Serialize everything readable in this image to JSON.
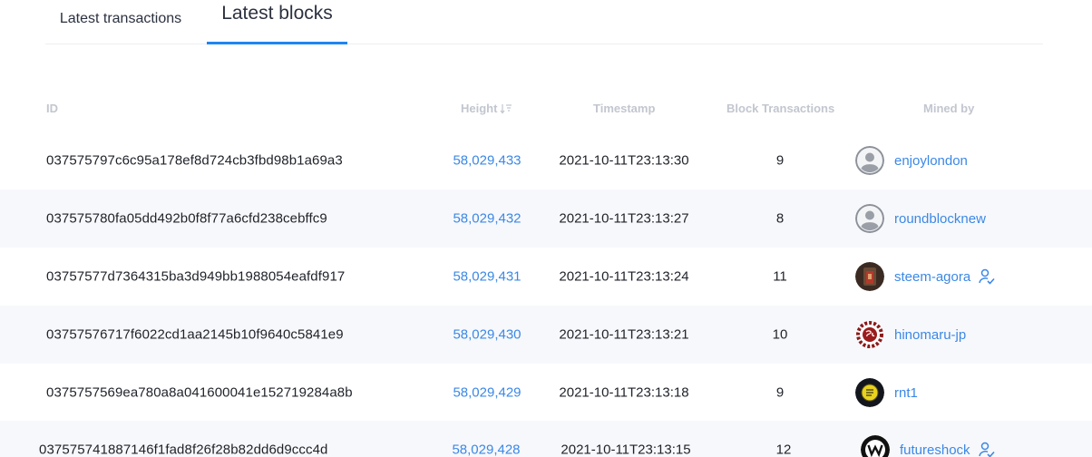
{
  "tabs": [
    {
      "label": "Latest transactions",
      "active": false
    },
    {
      "label": "Latest blocks",
      "active": true
    }
  ],
  "table": {
    "columns": [
      "ID",
      "Height",
      "Timestamp",
      "Block Transactions",
      "Mined by"
    ],
    "sort_icon": "sort-descending-icon",
    "rows": [
      {
        "id": "037575797c6c95a178ef8d724cb3fbd98b1a69a3",
        "height": "58,029,433",
        "timestamp": "2021-10-11T23:13:30",
        "tx_count": "9",
        "miner": "enjoylondon",
        "avatar": "default-user-icon",
        "verified": false
      },
      {
        "id": "037575780fa05dd492b0f8f77a6cfd238cebffc9",
        "height": "58,029,432",
        "timestamp": "2021-10-11T23:13:27",
        "tx_count": "8",
        "miner": "roundblocknew",
        "avatar": "default-user-icon",
        "verified": false
      },
      {
        "id": "03757577d7364315ba3d949bb1988054eafdf917",
        "height": "58,029,431",
        "timestamp": "2021-10-11T23:13:24",
        "tx_count": "11",
        "miner": "steem-agora",
        "avatar": "steem-agora-avatar",
        "verified": true
      },
      {
        "id": "03757576717f6022cd1aa2145b10f9640c5841e9",
        "height": "58,029,430",
        "timestamp": "2021-10-11T23:13:21",
        "tx_count": "10",
        "miner": "hinomaru-jp",
        "avatar": "hinomaru-avatar",
        "verified": false
      },
      {
        "id": "0375757569ea780a8a041600041e152719284a8b",
        "height": "58,029,429",
        "timestamp": "2021-10-11T23:13:18",
        "tx_count": "9",
        "miner": "rnt1",
        "avatar": "rnt1-avatar",
        "verified": false
      },
      {
        "id": "037575741887146f1fad8f26f28b82dd6d9ccc4d",
        "height": "58,029,428",
        "timestamp": "2021-10-11T23:13:15",
        "tx_count": "12",
        "miner": "futureshock",
        "avatar": "futureshock-avatar",
        "verified": true
      }
    ]
  },
  "colors": {
    "accent": "#1e86f2",
    "link": "#3b88e6",
    "header_text": "#c2c6cf",
    "row_alt_bg": "#f7f8fb"
  }
}
